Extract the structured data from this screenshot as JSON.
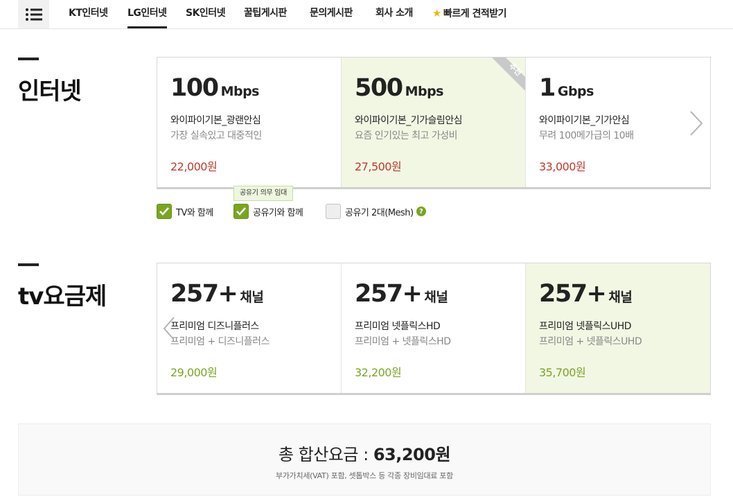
{
  "nav": {
    "items": [
      "KT인터넷",
      "LG인터넷",
      "SK인터넷",
      "꿀팁게시판",
      "문의게시판",
      "회사 소개",
      "빠르게 견적받기"
    ],
    "active_index": 1
  },
  "internet": {
    "title": "인터넷",
    "plans": [
      {
        "speed": "100",
        "unit": "Mbps",
        "name": "와이파이기본_광랜안심",
        "desc": "가장 실속있고 대중적인",
        "price": "22,000원"
      },
      {
        "speed": "500",
        "unit": "Mbps",
        "name": "와이파이기본_기가슬림안심",
        "desc": "요즘 인기있는 최고 가성비",
        "price": "27,500원",
        "badge": "추천"
      },
      {
        "speed": "1",
        "unit": "Gbps",
        "name": "와이파이기본_기가안심",
        "desc": "무려 100메가급의 10배",
        "price": "33,000원"
      }
    ],
    "selected_index": 1,
    "options": [
      {
        "label": "TV와 함께",
        "checked": true
      },
      {
        "label": "공유기와 함께",
        "checked": true
      },
      {
        "label": "공유기 2대(Mesh)",
        "checked": false
      }
    ],
    "tooltip": "공유기 의무 임대",
    "help_icon": "?"
  },
  "tv": {
    "title": "tv요금제",
    "plans": [
      {
        "channels": "257+",
        "unit": "채널",
        "name": "프리미엄 디즈니플러스",
        "desc": "프리미엄 + 디즈니플러스",
        "price": "29,000원"
      },
      {
        "channels": "257+",
        "unit": "채널",
        "name": "프리미엄 넷플릭스HD",
        "desc": "프리미엄 + 넷플릭스HD",
        "price": "32,200원"
      },
      {
        "channels": "257+",
        "unit": "채널",
        "name": "프리미엄 넷플릭스UHD",
        "desc": "프리미엄 + 넷플릭스UHD",
        "price": "35,700원"
      }
    ],
    "selected_index": 2
  },
  "total": {
    "label": "총 합산요금 : ",
    "amount": "63,200원",
    "note": "부가가치세(VAT) 포함, 셋톱박스 등 각종 장비임대료 포함"
  },
  "colors": {
    "accent_green": "#7aa521",
    "price_red": "#c0392b",
    "selected_bg": "#f2f7e4",
    "star": "#f5b400"
  },
  "icons": {
    "menu": "hamburger-menu-icon",
    "quote": "star-icon",
    "next": "chevron-right-icon",
    "prev": "chevron-left-icon",
    "check": "checkmark-icon",
    "help": "question-circle-icon"
  }
}
